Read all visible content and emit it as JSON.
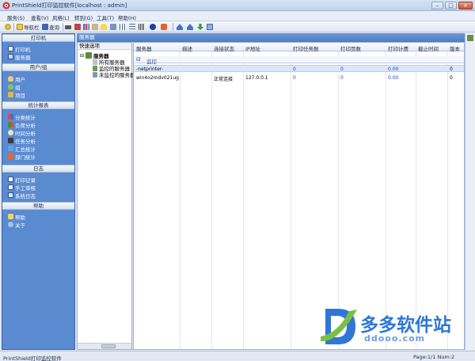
{
  "window": {
    "title": "PrintShield打印监控软件[localhost : admin]",
    "minimize_label": "–",
    "maximize_label": "□",
    "close_label": "×"
  },
  "menu": [
    "服务(S)",
    "查看(V)",
    "风格(L)",
    "转到(G)",
    "工具(T)",
    "帮助(H)"
  ],
  "toolbar": {
    "nav_label": "导航栏",
    "query_label": "查询"
  },
  "sidebar": {
    "sections": [
      {
        "title": "打印机",
        "items": [
          {
            "label": "打印机",
            "icon": "printer-icon"
          },
          {
            "label": "服务器",
            "icon": "server-icon"
          }
        ]
      },
      {
        "title": "用户/组",
        "items": [
          {
            "label": "用户",
            "icon": "user-icon"
          },
          {
            "label": "组",
            "icon": "group-icon"
          },
          {
            "label": "项目",
            "icon": "project-icon"
          }
        ]
      },
      {
        "title": "统计报表",
        "items": [
          {
            "label": "分类统计",
            "icon": "chart-icon"
          },
          {
            "label": "负荷分析",
            "icon": "load-icon"
          },
          {
            "label": "时间分析",
            "icon": "clock-icon"
          },
          {
            "label": "任务分析",
            "icon": "task-icon"
          },
          {
            "label": "汇总统计",
            "icon": "summary-icon"
          },
          {
            "label": "部门统计",
            "icon": "department-icon"
          }
        ]
      },
      {
        "title": "日志",
        "items": [
          {
            "label": "打印记录",
            "icon": "log-icon"
          },
          {
            "label": "手工审核",
            "icon": "audit-icon"
          },
          {
            "label": "系统日志",
            "icon": "syslog-icon"
          }
        ]
      },
      {
        "title": "帮助",
        "items": [
          {
            "label": "帮助",
            "icon": "help-icon"
          },
          {
            "label": "关于",
            "icon": "about-icon"
          }
        ]
      }
    ]
  },
  "panel": {
    "title": "服务器",
    "tree_header": "快速选项",
    "tree": {
      "root": "服务器",
      "children": [
        "所有服务器",
        "监控的服务器",
        "未监控的服务器"
      ]
    }
  },
  "grid": {
    "columns": [
      "服务器",
      "描述",
      "连接状态",
      "IP地址",
      "打印任务数",
      "打印页数",
      "打印计费",
      "截止时间",
      "版本"
    ],
    "group_label": "监控",
    "rows": [
      [
        "-netprinter-",
        "",
        "",
        "",
        "0",
        "0",
        "0.00",
        "",
        "0"
      ],
      [
        "win4o2mdv021ug",
        "",
        "正常连接",
        "127.0.0.1",
        "0",
        "0",
        "0.00",
        "",
        "0"
      ]
    ]
  },
  "status": {
    "app_name": "PrintShield打印监控软件",
    "page_info": "Page:1/1 Num:2"
  },
  "watermark": {
    "brand": "多多软件站",
    "url": "ddooo.com"
  },
  "colors": {
    "sidebar": "#4f7ec2",
    "sidebar_body": "#5a8ad0",
    "selection": "#dbe8fb",
    "value_blue": "#1f3fd1",
    "watermark_blue": "#2f77d6",
    "watermark_green": "#7ac143"
  }
}
